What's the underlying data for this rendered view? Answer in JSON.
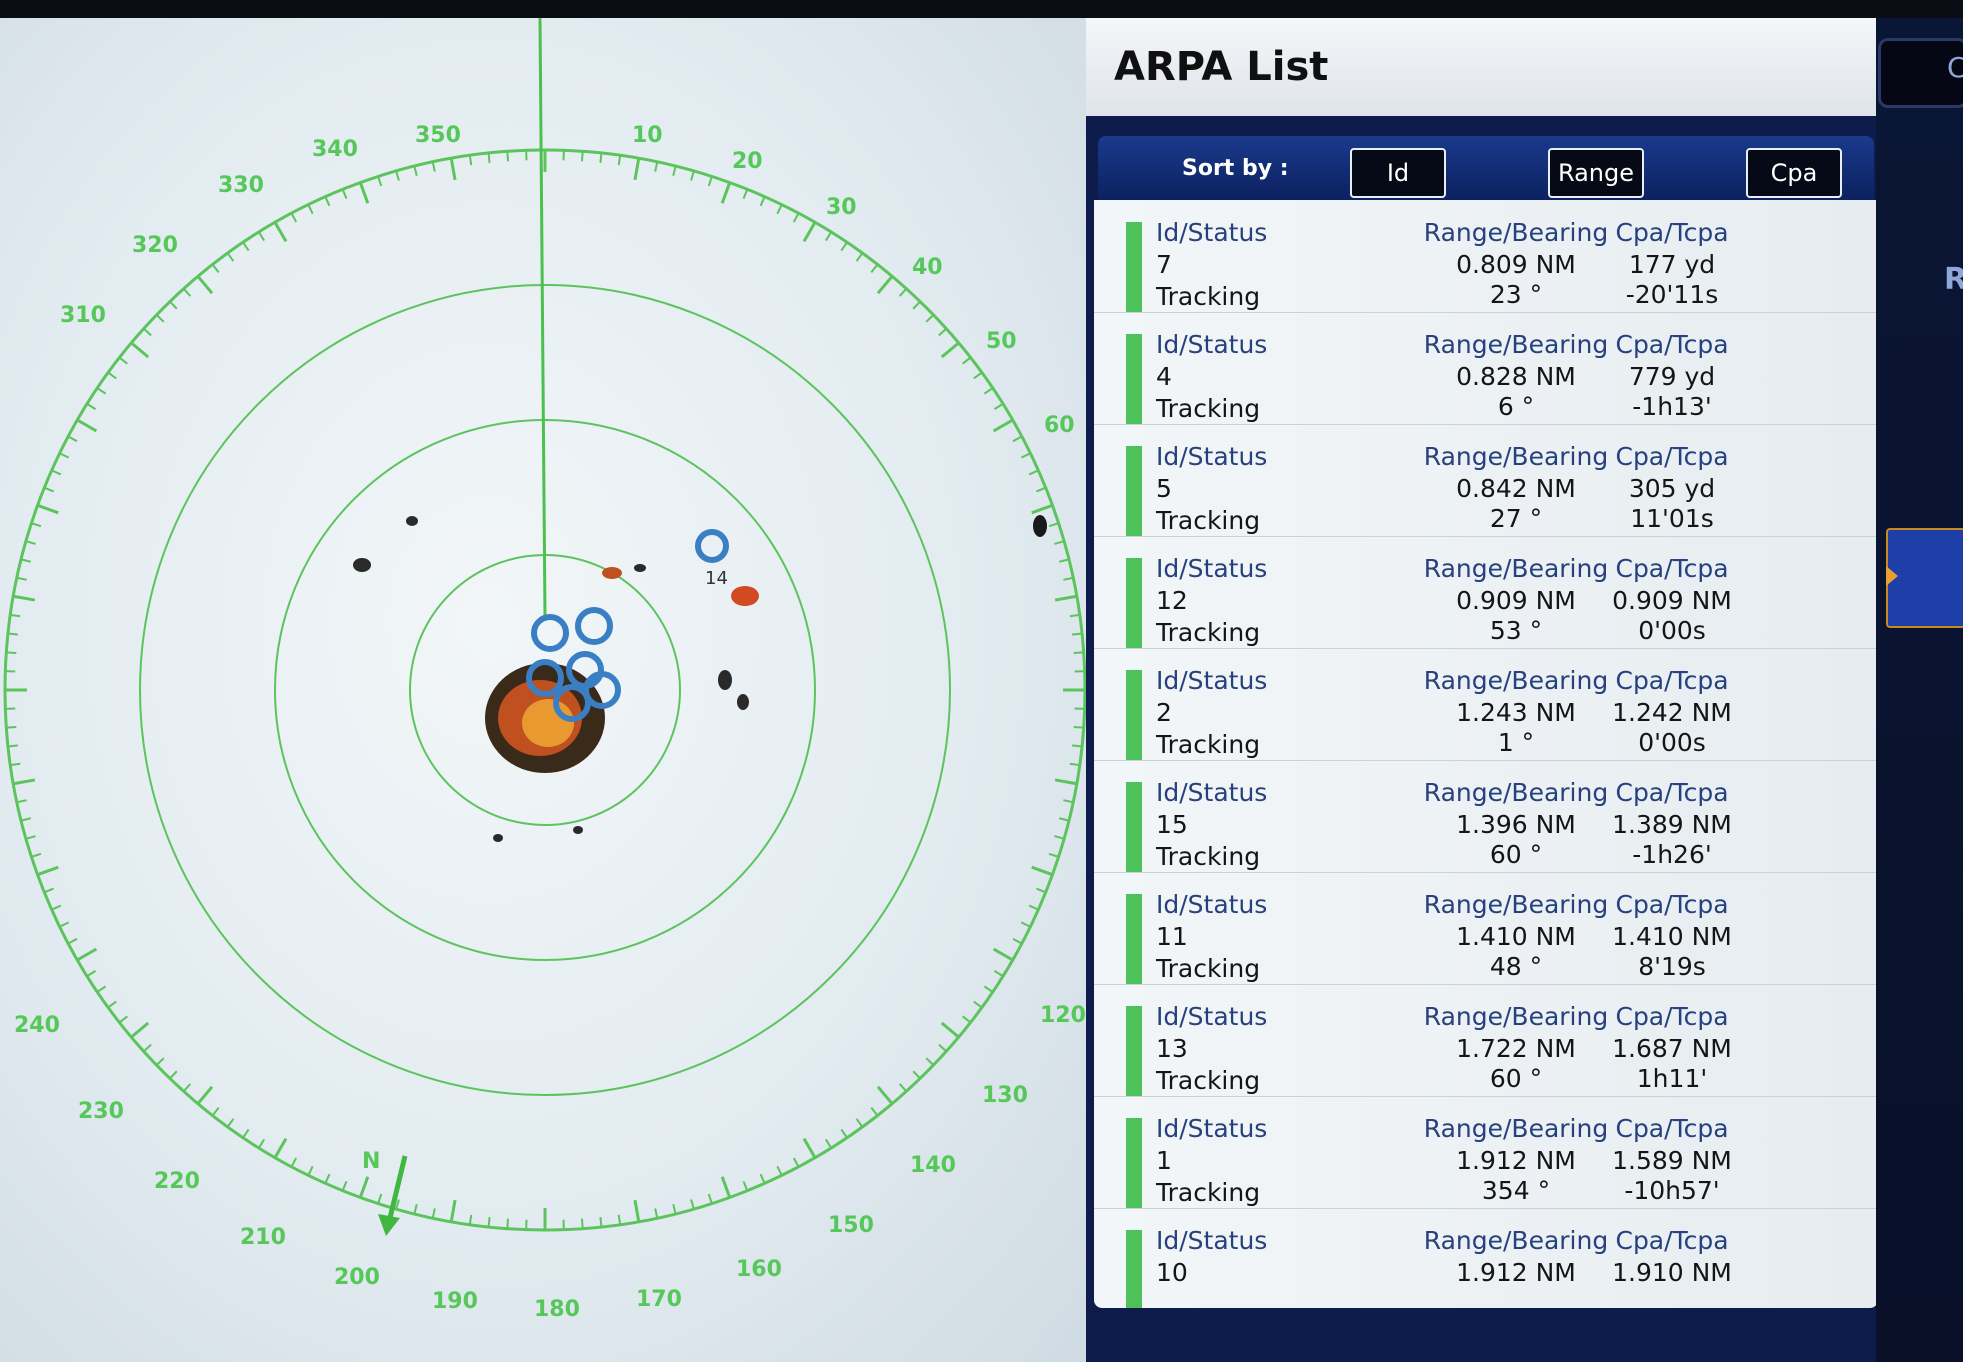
{
  "panel": {
    "title": "ARPA List",
    "sort_label": "Sort by :",
    "sort_buttons": [
      "Id",
      "Range",
      "Cpa"
    ]
  },
  "columns": {
    "id_status": "Id/Status",
    "range_bearing": "Range/Bearing",
    "cpa_tcpa": "Cpa/Tcpa"
  },
  "targets": [
    {
      "id": "7",
      "status": "Tracking",
      "range": "0.809 NM",
      "bearing": "23 °",
      "cpa": "177 yd",
      "tcpa": "-20'11s"
    },
    {
      "id": "4",
      "status": "Tracking",
      "range": "0.828 NM",
      "bearing": "6 °",
      "cpa": "779 yd",
      "tcpa": "-1h13'"
    },
    {
      "id": "5",
      "status": "Tracking",
      "range": "0.842 NM",
      "bearing": "27 °",
      "cpa": "305 yd",
      "tcpa": "11'01s"
    },
    {
      "id": "12",
      "status": "Tracking",
      "range": "0.909 NM",
      "bearing": "53 °",
      "cpa": "0.909 NM",
      "tcpa": "0'00s"
    },
    {
      "id": "2",
      "status": "Tracking",
      "range": "1.243 NM",
      "bearing": "1 °",
      "cpa": "1.242 NM",
      "tcpa": "0'00s"
    },
    {
      "id": "15",
      "status": "Tracking",
      "range": "1.396 NM",
      "bearing": "60 °",
      "cpa": "1.389 NM",
      "tcpa": "-1h26'"
    },
    {
      "id": "11",
      "status": "Tracking",
      "range": "1.410 NM",
      "bearing": "48 °",
      "cpa": "1.410 NM",
      "tcpa": "8'19s"
    },
    {
      "id": "13",
      "status": "Tracking",
      "range": "1.722 NM",
      "bearing": "60 °",
      "cpa": "1.687 NM",
      "tcpa": "1h11'"
    },
    {
      "id": "1",
      "status": "Tracking",
      "range": "1.912 NM",
      "bearing": "354 °",
      "cpa": "1.589 NM",
      "tcpa": "-10h57'"
    },
    {
      "id": "10",
      "status": "",
      "range": "1.912 NM",
      "bearing": "",
      "cpa": "1.910 NM",
      "tcpa": ""
    }
  ],
  "radar": {
    "bearing_labels": [
      "350",
      "10",
      "20",
      "30",
      "40",
      "50",
      "60",
      "120",
      "130",
      "140",
      "150",
      "160",
      "170",
      "180",
      "190",
      "200",
      "210",
      "220",
      "230",
      "240",
      "310",
      "320",
      "330",
      "340"
    ],
    "north_marker": "N",
    "target_label": "14"
  },
  "side": {
    "top_button": "C",
    "label": "R"
  },
  "colors": {
    "ring": "#5cc45c",
    "bearing_text": "#56c85a",
    "status_bar": "#4ec25a",
    "target_symbol": "#3a7fc4"
  }
}
